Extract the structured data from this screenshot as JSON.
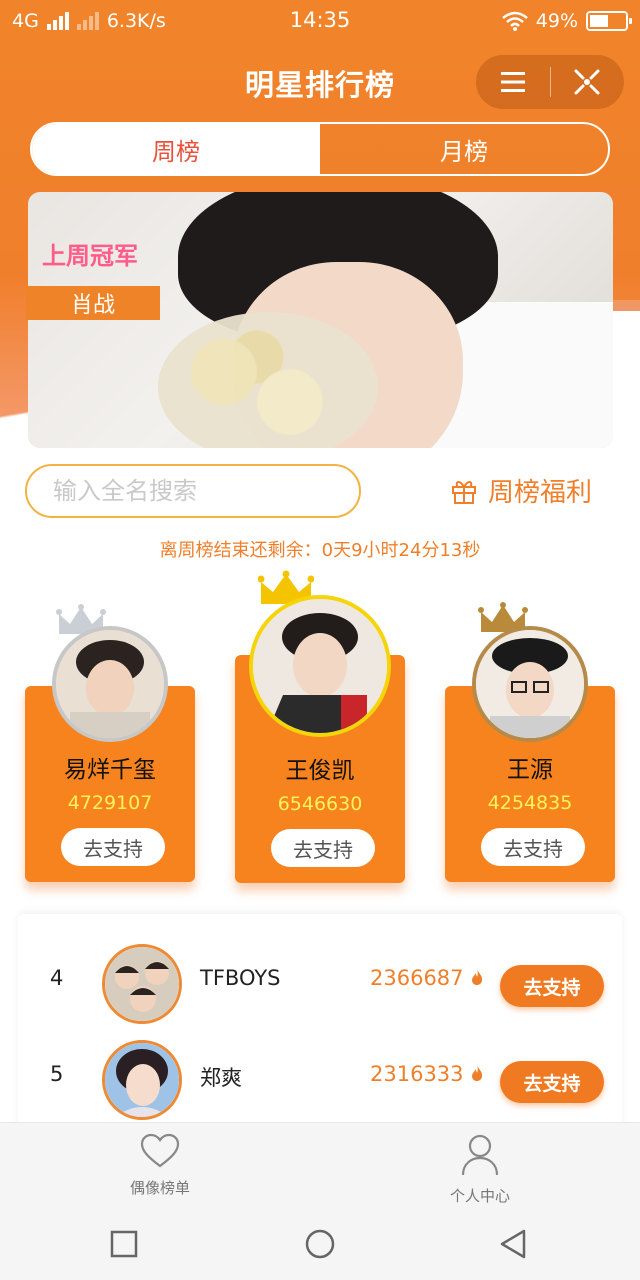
{
  "status_bar": {
    "network": "4G",
    "speed": "6.3K/s",
    "time": "14:35",
    "battery": "49%"
  },
  "header": {
    "title": "明星排行榜",
    "menu_icon": "menu-icon",
    "close_icon": "close-target-icon"
  },
  "tabs": [
    {
      "label": "周榜",
      "active": true
    },
    {
      "label": "月榜",
      "active": false
    }
  ],
  "banner": {
    "champion_label": "上周冠军",
    "champion_name": "肖战"
  },
  "search": {
    "placeholder": "输入全名搜索",
    "icon": "search-icon"
  },
  "welfare": {
    "label": "周榜福利",
    "icon": "gift-icon"
  },
  "countdown": "离周榜结束还剩余：0天9小时24分13秒",
  "podium": [
    {
      "rank": 2,
      "name": "易烊千玺",
      "score": "4729107",
      "support_label": "去支持",
      "crown_color": "#c9cfd4"
    },
    {
      "rank": 1,
      "name": "王俊凯",
      "score": "6546630",
      "support_label": "去支持",
      "crown_color": "#f5c400"
    },
    {
      "rank": 3,
      "name": "王源",
      "score": "4254835",
      "support_label": "去支持",
      "crown_color": "#b88a3a"
    }
  ],
  "ranking_list": [
    {
      "rank": "4",
      "name": "TFBOYS",
      "score": "2366687",
      "support_label": "去支持"
    },
    {
      "rank": "5",
      "name": "郑爽",
      "score": "2316333",
      "support_label": "去支持"
    }
  ],
  "bottom_nav": [
    {
      "label": "偶像榜单",
      "icon": "heart-icon"
    },
    {
      "label": "个人中心",
      "icon": "person-icon"
    }
  ],
  "colors": {
    "brand_orange": "#f6831e",
    "score_yellow": "#fff35a",
    "champion_pink": "#ff5c8a"
  }
}
